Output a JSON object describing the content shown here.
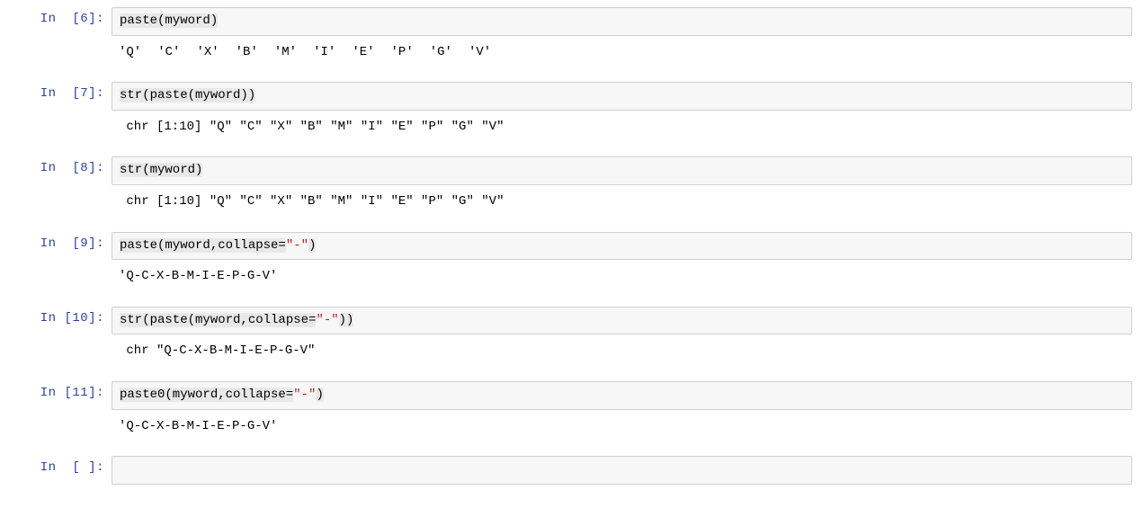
{
  "cells": [
    {
      "prompt": "In  [6]:",
      "input_tokens": [
        {
          "t": "paste(myword)",
          "cls": "tok-call"
        }
      ],
      "output_items": [
        "'Q'",
        "'C'",
        "'X'",
        "'B'",
        "'M'",
        "'I'",
        "'E'",
        "'P'",
        "'G'",
        "'V'"
      ],
      "output_plain": null
    },
    {
      "prompt": "In  [7]:",
      "input_tokens": [
        {
          "t": "str(paste(myword))",
          "cls": "tok-call"
        }
      ],
      "output_items": null,
      "output_plain": " chr [1:10] \"Q\" \"C\" \"X\" \"B\" \"M\" \"I\" \"E\" \"P\" \"G\" \"V\""
    },
    {
      "prompt": "In  [8]:",
      "input_tokens": [
        {
          "t": "str(myword)",
          "cls": "tok-call"
        }
      ],
      "output_items": null,
      "output_plain": " chr [1:10] \"Q\" \"C\" \"X\" \"B\" \"M\" \"I\" \"E\" \"P\" \"G\" \"V\""
    },
    {
      "prompt": "In  [9]:",
      "input_tokens": [
        {
          "t": "paste(myword,collapse=",
          "cls": "tok-call"
        },
        {
          "t": "\"-\"",
          "cls": "tok-str"
        },
        {
          "t": ")",
          "cls": "tok-call"
        }
      ],
      "output_items": null,
      "output_plain": "'Q-C-X-B-M-I-E-P-G-V'"
    },
    {
      "prompt": "In [10]:",
      "input_tokens": [
        {
          "t": "str(paste(myword,collapse=",
          "cls": "tok-call"
        },
        {
          "t": "\"-\"",
          "cls": "tok-str"
        },
        {
          "t": "))",
          "cls": "tok-call"
        }
      ],
      "output_items": null,
      "output_plain": " chr \"Q-C-X-B-M-I-E-P-G-V\""
    },
    {
      "prompt": "In [11]:",
      "input_tokens": [
        {
          "t": "paste0(myword,collapse=",
          "cls": "tok-call"
        },
        {
          "t": "\"-\"",
          "cls": "tok-str"
        },
        {
          "t": ")",
          "cls": "tok-call"
        }
      ],
      "output_items": null,
      "output_plain": "'Q-C-X-B-M-I-E-P-G-V'"
    },
    {
      "prompt": "In  [ ]:",
      "input_tokens": [
        {
          "t": " ",
          "cls": ""
        }
      ],
      "output_items": null,
      "output_plain": null
    }
  ]
}
